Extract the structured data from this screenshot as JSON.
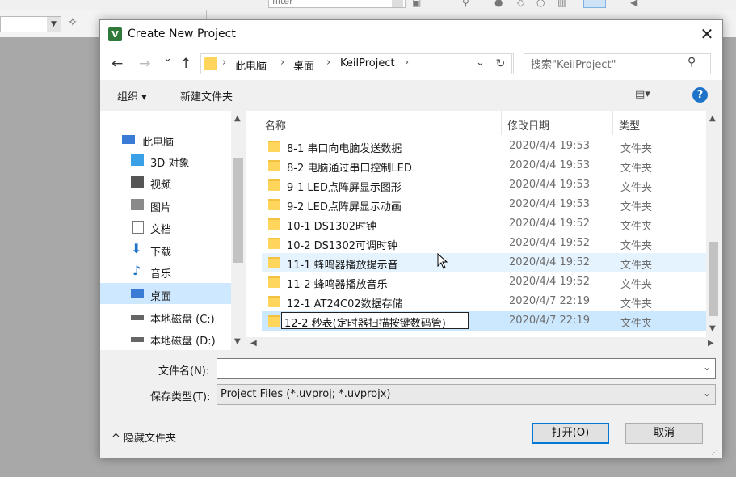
{
  "dialog": {
    "title": "Create New Project",
    "app_icon_letter": "V",
    "close_glyph": "✕"
  },
  "nav": {
    "back": "←",
    "forward": "→",
    "recent": "⌄",
    "up": "↑",
    "breadcrumb": [
      "此电脑",
      "桌面",
      "KeilProject"
    ],
    "chevron": "›",
    "dropdown": "⌄",
    "refresh": "↻",
    "search_placeholder": "搜索\"KeilProject\"",
    "search_icon": "⚲"
  },
  "commands": {
    "organize": "组织 ▾",
    "new_folder": "新建文件夹",
    "view": "▤▾",
    "help": "?"
  },
  "tree": {
    "items": [
      {
        "label": "此电脑",
        "icon": "computer-icon",
        "color": "#3a7bd5"
      },
      {
        "label": "3D 对象",
        "icon": "3d-objects-icon",
        "color": "#3aa0e8"
      },
      {
        "label": "视频",
        "icon": "video-icon",
        "color": "#555555"
      },
      {
        "label": "图片",
        "icon": "pictures-icon",
        "color": "#666666"
      },
      {
        "label": "文档",
        "icon": "documents-icon",
        "color": "#777777"
      },
      {
        "label": "下载",
        "icon": "downloads-icon",
        "color": "#1e73c8"
      },
      {
        "label": "音乐",
        "icon": "music-icon",
        "color": "#1e73c8"
      },
      {
        "label": "桌面",
        "icon": "desktop-icon",
        "color": "#3a7bd5"
      },
      {
        "label": "本地磁盘 (C:)",
        "icon": "drive-c-icon",
        "color": "#666666"
      },
      {
        "label": "本地磁盘 (D:)",
        "icon": "drive-d-icon",
        "color": "#666666"
      }
    ],
    "selected_index": 7
  },
  "list": {
    "columns": [
      "名称",
      "修改日期",
      "类型"
    ],
    "sort_glyph": "^",
    "rows": [
      {
        "name": "8-1 串口向电脑发送数据",
        "date": "2020/4/4 19:53",
        "type": "文件夹"
      },
      {
        "name": "8-2 电脑通过串口控制LED",
        "date": "2020/4/4 19:53",
        "type": "文件夹"
      },
      {
        "name": "9-1 LED点阵屏显示图形",
        "date": "2020/4/4 19:53",
        "type": "文件夹"
      },
      {
        "name": "9-2 LED点阵屏显示动画",
        "date": "2020/4/4 19:53",
        "type": "文件夹"
      },
      {
        "name": "10-1 DS1302时钟",
        "date": "2020/4/4 19:52",
        "type": "文件夹"
      },
      {
        "name": "10-2 DS1302可调时钟",
        "date": "2020/4/4 19:52",
        "type": "文件夹"
      },
      {
        "name": "11-1 蜂鸣器播放提示音",
        "date": "2020/4/4 19:52",
        "type": "文件夹"
      },
      {
        "name": "11-2 蜂鸣器播放音乐",
        "date": "2020/4/4 19:52",
        "type": "文件夹"
      },
      {
        "name": "12-1 AT24C02数据存储",
        "date": "2020/4/7 22:19",
        "type": "文件夹"
      },
      {
        "name": "12-2 秒表(定时器扫描按键数码管)",
        "date": "2020/4/7 22:19",
        "type": "文件夹"
      }
    ],
    "hover_index": 6,
    "renaming_index": 9
  },
  "bottom": {
    "filename_label": "文件名(N):",
    "filename_value": "",
    "filetype_label": "保存类型(T):",
    "filetype_value": "Project Files (*.uvproj; *.uvprojx)",
    "hide_folders": "隐藏文件夹",
    "hide_glyph": "^",
    "open_button": "打开(O)",
    "cancel_button": "取消"
  },
  "background": {
    "filter_text": "filter"
  },
  "colors": {
    "accent": "#0078d7",
    "selection": "#cde8ff",
    "hover": "#e5f3ff",
    "folder": "#ffd55c"
  }
}
